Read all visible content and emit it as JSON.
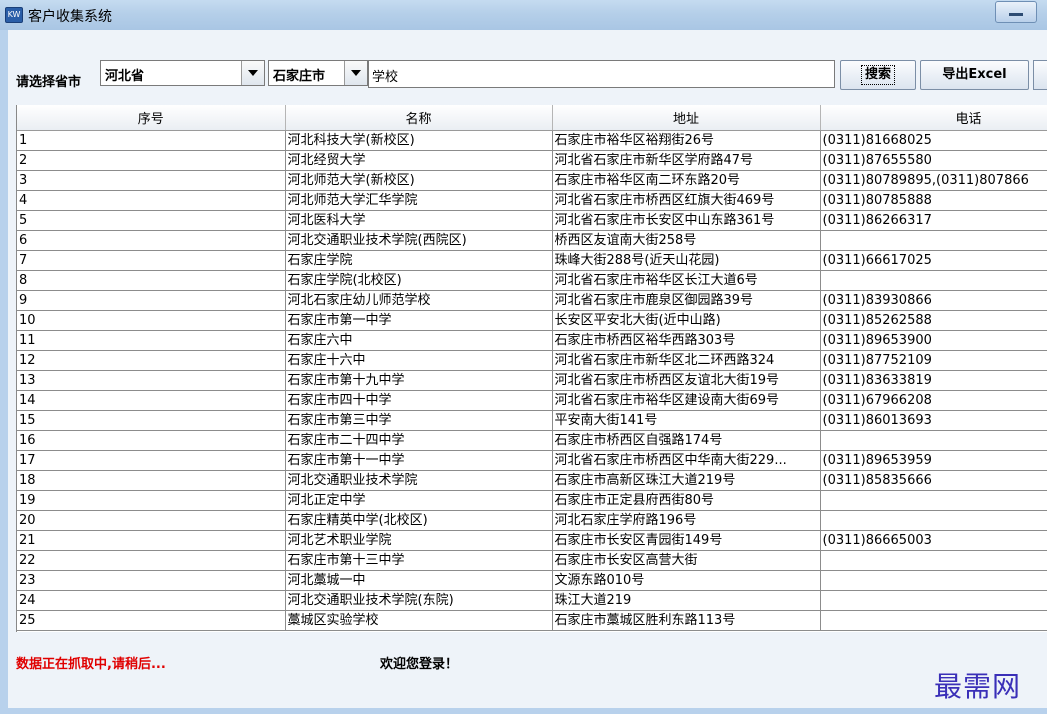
{
  "window": {
    "title": "客户收集系统",
    "icon_text": "KW"
  },
  "toolbar": {
    "province_label": "请选择省市",
    "province_value": "河北省",
    "city_value": "石家庄市",
    "search_value": "学校",
    "search_button": "搜索",
    "export_button": "导出Excel"
  },
  "table": {
    "headers": [
      "序号",
      "名称",
      "地址",
      "电话"
    ],
    "rows": [
      [
        "1",
        "河北科技大学(新校区)",
        "石家庄市裕华区裕翔街26号",
        "(0311)81668025"
      ],
      [
        "2",
        "河北经贸大学",
        "河北省石家庄市新华区学府路47号",
        "(0311)87655580"
      ],
      [
        "3",
        "河北师范大学(新校区)",
        "石家庄市裕华区南二环东路20号",
        "(0311)80789895,(0311)807866"
      ],
      [
        "4",
        "河北师范大学汇华学院",
        "河北省石家庄市桥西区红旗大街469号",
        "(0311)80785888"
      ],
      [
        "5",
        "河北医科大学",
        "河北省石家庄市长安区中山东路361号",
        "(0311)86266317"
      ],
      [
        "6",
        "河北交通职业技术学院(西院区)",
        "桥西区友谊南大街258号",
        ""
      ],
      [
        "7",
        "石家庄学院",
        "珠峰大街288号(近天山花园)",
        "(0311)66617025"
      ],
      [
        "8",
        "石家庄学院(北校区)",
        "河北省石家庄市裕华区长江大道6号",
        ""
      ],
      [
        "9",
        "河北石家庄幼儿师范学校",
        "河北省石家庄市鹿泉区御园路39号",
        "(0311)83930866"
      ],
      [
        "10",
        "石家庄市第一中学",
        "长安区平安北大街(近中山路)",
        "(0311)85262588"
      ],
      [
        "11",
        "石家庄六中",
        "石家庄市桥西区裕华西路303号",
        "(0311)89653900"
      ],
      [
        "12",
        "石家庄十六中",
        "河北省石家庄市新华区北二环西路324",
        "(0311)87752109"
      ],
      [
        "13",
        "石家庄市第十九中学",
        "河北省石家庄市桥西区友谊北大街19号",
        "(0311)83633819"
      ],
      [
        "14",
        "石家庄市四十中学",
        "河北省石家庄市裕华区建设南大街69号",
        "(0311)67966208"
      ],
      [
        "15",
        "石家庄市第三中学",
        "平安南大街141号",
        "(0311)86013693"
      ],
      [
        "16",
        "石家庄市二十四中学",
        "石家庄市桥西区自强路174号",
        ""
      ],
      [
        "17",
        "石家庄市第十一中学",
        "河北省石家庄市桥西区中华南大街229...",
        "(0311)89653959"
      ],
      [
        "18",
        "河北交通职业技术学院",
        "石家庄市高新区珠江大道219号",
        "(0311)85835666"
      ],
      [
        "19",
        "河北正定中学",
        "石家庄市正定县府西街80号",
        ""
      ],
      [
        "20",
        "石家庄精英中学(北校区)",
        "河北石家庄学府路196号",
        ""
      ],
      [
        "21",
        "河北艺术职业学院",
        "石家庄市长安区青园街149号",
        "(0311)86665003"
      ],
      [
        "22",
        "石家庄市第十三中学",
        "石家庄市长安区高营大街",
        ""
      ],
      [
        "23",
        "河北藁城一中",
        "文源东路010号",
        ""
      ],
      [
        "24",
        "河北交通职业技术学院(东院)",
        "珠江大道219",
        ""
      ],
      [
        "25",
        "藁城区实验学校",
        "石家庄市藁城区胜利东路113号",
        ""
      ]
    ]
  },
  "footer": {
    "status": "数据正在抓取中,请稍后...",
    "welcome": "欢迎您登录！"
  },
  "watermark": "最需网"
}
